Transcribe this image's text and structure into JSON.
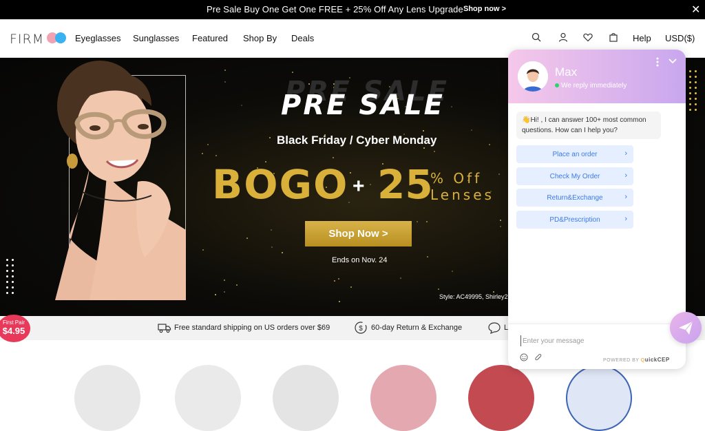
{
  "announcement": {
    "message": "Pre Sale Buy One Get One FREE + 25% Off Any Lens Upgrade",
    "link": "Shop now >",
    "close": "✕"
  },
  "nav": {
    "logo_text": "FIRM",
    "items": [
      "Eyeglasses",
      "Sunglasses",
      "Featured",
      "Shop By",
      "Deals"
    ],
    "help": "Help",
    "currency": "USD($)"
  },
  "hero": {
    "headline": "PRE SALE",
    "subheadline": "Black Friday / Cyber Monday",
    "bogo": "BOGO",
    "plus": "+",
    "percent": "25",
    "percent_suffix_1": "% Off",
    "percent_suffix_2": "Lenses",
    "cta": "Shop Now >",
    "ends": "Ends on Nov. 24",
    "style": "Style: AC49995, Shirley2"
  },
  "benefits": {
    "shipping": "Free standard shipping on US orders over $69",
    "returns": "60-day Return & Exchange",
    "third": "L"
  },
  "first_pair": {
    "label": "First Pair",
    "price": "$4.95"
  },
  "chat": {
    "agent_name": "Max",
    "status": "We reply immediately",
    "greeting": "👋Hi! , I can answer 100+ most common questions. How can I help you?",
    "quick_replies": [
      "Place an order",
      "Check My Order",
      "Return&Exchange",
      "PD&Prescription"
    ],
    "input_placeholder": "Enter your message",
    "powered_by": "POWERED BY",
    "brand": "uickCEP",
    "brand_q": "Q"
  },
  "colors": {
    "gold": "#d9b03a",
    "chat_accent": "#3d7ae8",
    "first_pair_red": "#e8395a"
  }
}
